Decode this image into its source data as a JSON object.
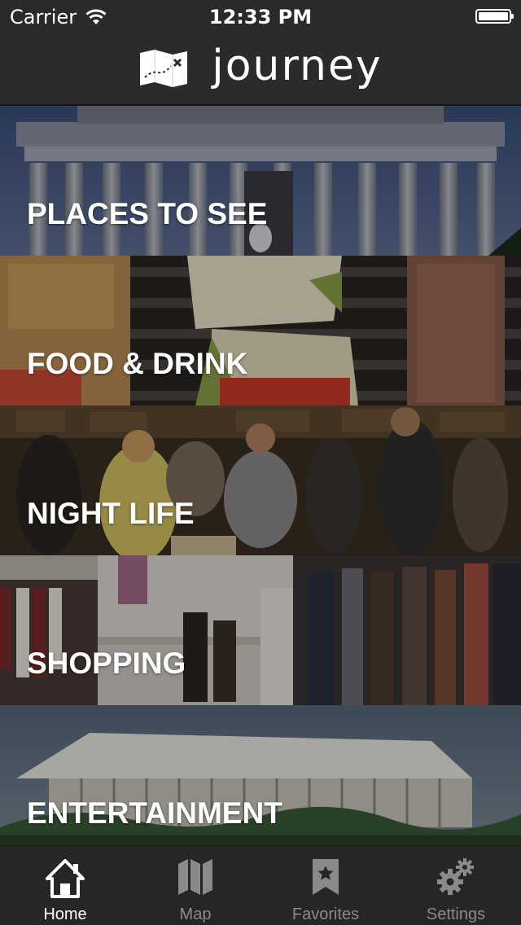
{
  "status_bar": {
    "carrier": "Carrier",
    "time": "12:33 PM"
  },
  "header": {
    "app_name": "journey",
    "logo_icon": "folded-map-icon"
  },
  "categories": [
    {
      "label": "PLACES TO SEE",
      "image": "memorial-columns-photo"
    },
    {
      "label": "FOOD & DRINK",
      "image": "grilled-skewers-photo"
    },
    {
      "label": "NIGHT LIFE",
      "image": "crowded-bar-photo"
    },
    {
      "label": "SHOPPING",
      "image": "clothing-store-photo"
    },
    {
      "label": "ENTERTAINMENT",
      "image": "concert-hall-building-photo"
    }
  ],
  "tab_bar": {
    "active_color": "#ffffff",
    "inactive_color": "#8a8a8a",
    "items": [
      {
        "label": "Home",
        "icon": "home-icon",
        "active": true
      },
      {
        "label": "Map",
        "icon": "map-icon",
        "active": false
      },
      {
        "label": "Favorites",
        "icon": "bookmark-star-icon",
        "active": false
      },
      {
        "label": "Settings",
        "icon": "gears-icon",
        "active": false
      }
    ]
  }
}
